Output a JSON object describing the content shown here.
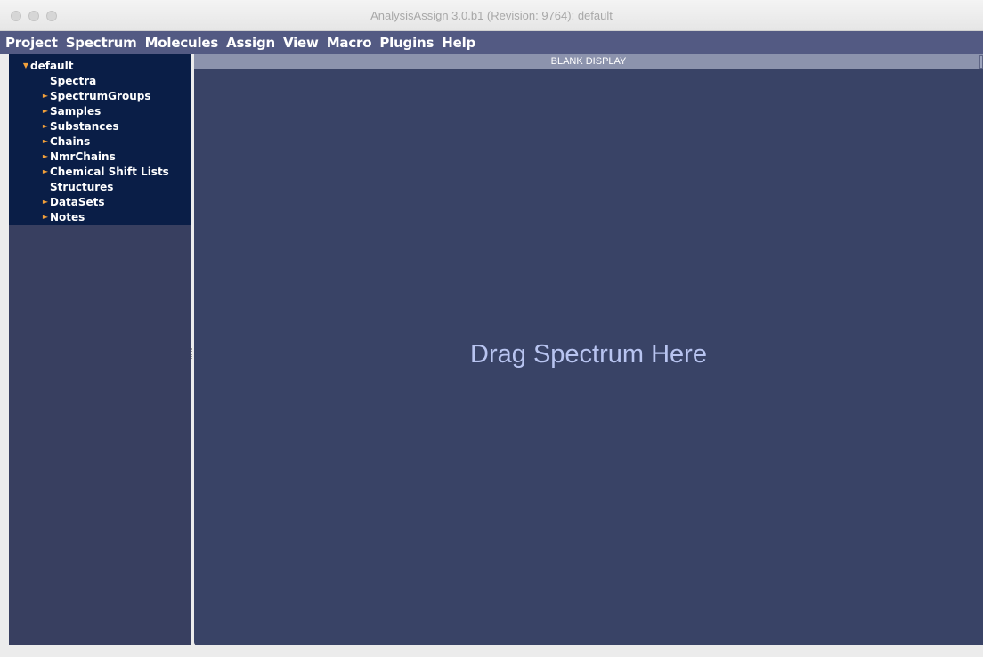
{
  "window": {
    "title": "AnalysisAssign 3.0.b1 (Revision: 9764): default"
  },
  "menubar": {
    "items": [
      "Project",
      "Spectrum",
      "Molecules",
      "Assign",
      "View",
      "Macro",
      "Plugins",
      "Help"
    ]
  },
  "sidebar": {
    "root": {
      "label": "default",
      "expanded": true
    },
    "items": [
      {
        "label": "Spectra",
        "has_children": false
      },
      {
        "label": "SpectrumGroups",
        "has_children": true
      },
      {
        "label": "Samples",
        "has_children": true
      },
      {
        "label": "Substances",
        "has_children": true
      },
      {
        "label": "Chains",
        "has_children": true
      },
      {
        "label": "NmrChains",
        "has_children": true
      },
      {
        "label": "Chemical Shift Lists",
        "has_children": true
      },
      {
        "label": "Structures",
        "has_children": false
      },
      {
        "label": "DataSets",
        "has_children": true
      },
      {
        "label": "Notes",
        "has_children": true
      }
    ]
  },
  "display": {
    "header": "BLANK DISPLAY",
    "placeholder": "Drag Spectrum Here"
  },
  "icons": {
    "collapsed": "triangle-right-icon",
    "expanded": "triangle-down-icon"
  },
  "colors": {
    "menubar": "#535a83",
    "tree_bg": "#0a1e47",
    "display_bg": "#394366",
    "arrow": "#f2a03a"
  }
}
